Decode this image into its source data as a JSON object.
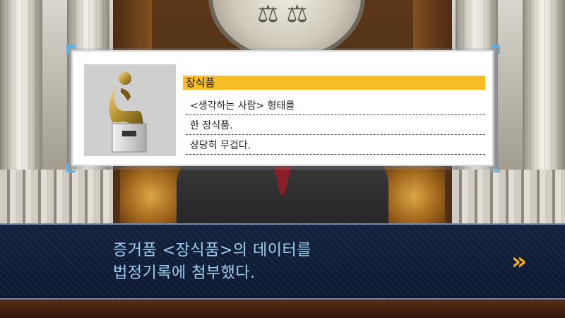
{
  "evidence": {
    "name": "장식품",
    "description_lines": [
      "<생각하는 사람> 형태를",
      "한 장식품.",
      "상당히 무겁다."
    ],
    "image_icon": "thinker-statue-icon"
  },
  "dialogue": {
    "lines": [
      "증거품 <장식품>의 데이터를",
      "법정기록에 첨부했다."
    ],
    "advance_icon": "double-chevron-right-icon"
  },
  "colors": {
    "title_highlight": "#f6bd27",
    "dialogue_text": "#9bd0f0",
    "dialogue_bg": "#13213d",
    "advance_arrow": "#f2b01e"
  }
}
